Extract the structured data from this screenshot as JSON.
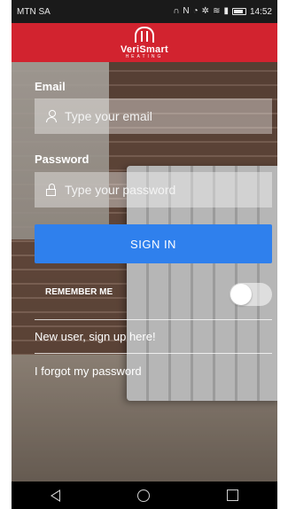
{
  "status_bar": {
    "carrier": "MTN SA",
    "time": "14:52",
    "icons": [
      "headphones-icon",
      "nfc-icon",
      "alarm-icon",
      "settings-icon",
      "wifi-icon",
      "signal-icon",
      "battery-icon"
    ]
  },
  "header": {
    "brand": "VeriSmart",
    "brand_sub": "HEATING",
    "color": "#d2232f"
  },
  "form": {
    "email_label": "Email",
    "email_placeholder": "Type your email",
    "password_label": "Password",
    "password_placeholder": "Type your password",
    "signin_label": "SIGN IN",
    "signin_color": "#2f80ed",
    "remember_label": "REMEMBER ME",
    "remember_on": false
  },
  "links": {
    "signup": "New user, sign up here!",
    "forgot": "I forgot my password"
  },
  "nav": {
    "icons": [
      "back-icon",
      "home-icon",
      "recents-icon"
    ]
  }
}
